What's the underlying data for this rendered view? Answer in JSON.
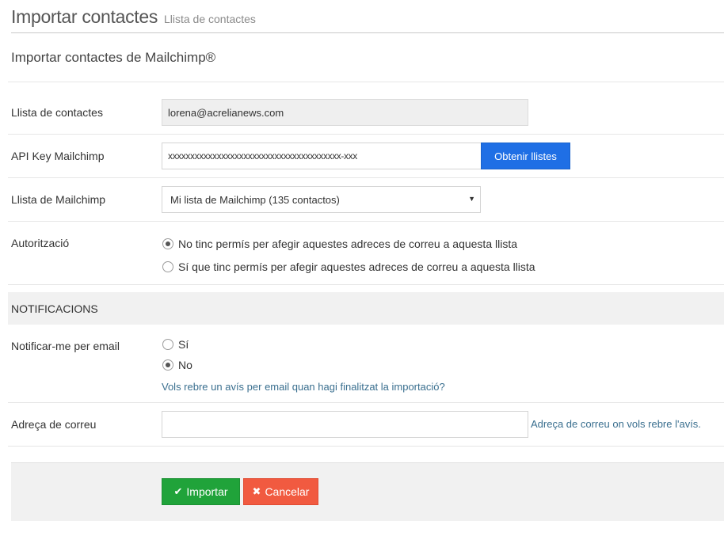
{
  "header": {
    "title": "Importar contactes",
    "subtitle": "Llista de contactes"
  },
  "section": {
    "title": "Importar contactes de Mailchimp®"
  },
  "form": {
    "contact_list": {
      "label": "Llista de contactes",
      "value": "lorena@acrelianews.com"
    },
    "api_key": {
      "label": "API Key Mailchimp",
      "value": "xxxxxxxxxxxxxxxxxxxxxxxxxxxxxxxxxxxxxxx-xxx",
      "button_label": "Obtenir llistes"
    },
    "mailchimp_list": {
      "label": "Llista de Mailchimp",
      "selected": "Mi lista de Mailchimp (135 contactos)"
    },
    "authorization": {
      "label": "Autorització",
      "options": [
        {
          "label": "No tinc permís per afegir aquestes adreces de correu a aquesta llista",
          "checked": true
        },
        {
          "label": "Sí que tinc permís per afegir aquestes adreces de correu a aquesta llista",
          "checked": false
        }
      ]
    }
  },
  "notifications": {
    "band_label": "NOTIFICACIONS",
    "notify_label": "Notificar-me per email",
    "options": [
      {
        "label": "Sí",
        "checked": false
      },
      {
        "label": "No",
        "checked": true
      }
    ],
    "help": "Vols rebre un avís per email quan hagi finalitzat la importació?",
    "email_label": "Adreça de correu",
    "email_value": "",
    "email_help": "Adreça de correu on vols rebre l'avís."
  },
  "footer": {
    "import_label": "Importar",
    "cancel_label": "Cancelar",
    "import_icon": "check-icon",
    "cancel_icon": "times-icon"
  },
  "colors": {
    "primary_blue": "#1f6fe5",
    "success_green": "#20a33a",
    "danger_red": "#f15a40",
    "help_text": "#3a6f8f"
  }
}
